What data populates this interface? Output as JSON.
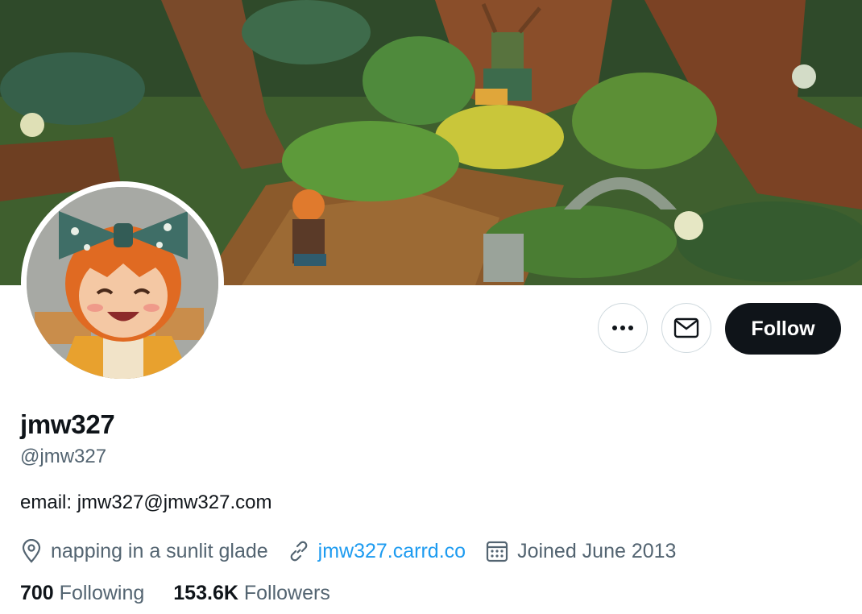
{
  "profile": {
    "display_name": "jmw327",
    "handle": "@jmw327",
    "bio": "email: jmw327@jmw327.com",
    "location": "napping in a sunlit glade",
    "website": "jmw327.carrd.co",
    "joined": "Joined June 2013"
  },
  "actions": {
    "more_icon": "more-horizontal-icon",
    "message_icon": "envelope-icon",
    "follow_label": "Follow"
  },
  "stats": {
    "following_count": "700",
    "following_label": "Following",
    "followers_count": "153.6K",
    "followers_label": "Followers"
  },
  "icons": {
    "location": "map-pin-icon",
    "website": "link-icon",
    "joined": "calendar-icon"
  },
  "colors": {
    "accent": "#1d9bf0",
    "text_primary": "#0f1419",
    "text_secondary": "#536471",
    "button_dark": "#0f1419",
    "border": "#cfd9de"
  }
}
